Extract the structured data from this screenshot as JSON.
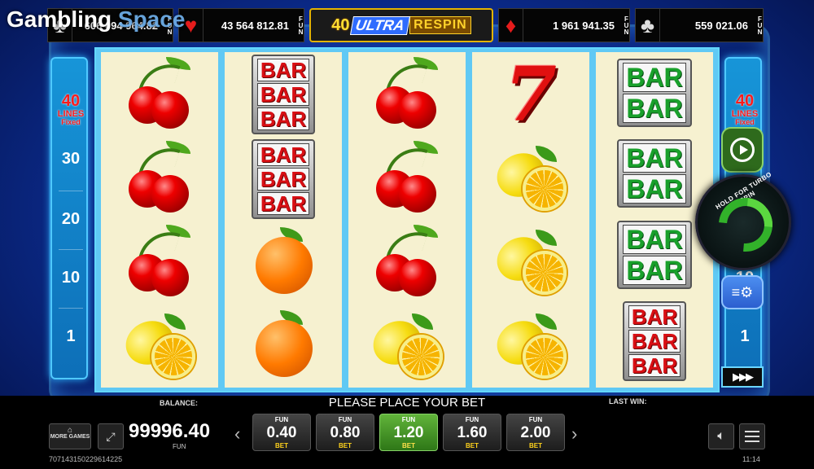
{
  "watermark": {
    "part1": "Gambling",
    "part2": "Space"
  },
  "jackpots": [
    {
      "suit": "club-icon",
      "glyph": "♣",
      "value": "606 094 964.82",
      "currency": "FUN"
    },
    {
      "suit": "heart-icon",
      "glyph": "♥",
      "value": "43 564 812.81",
      "currency": "FUN"
    },
    {
      "suit": "diamond-icon",
      "glyph": "♦",
      "value": "1 961 941.35",
      "currency": "FUN"
    },
    {
      "suit": "club-icon",
      "glyph": "♣",
      "value": "559 021.06",
      "currency": "FUN"
    }
  ],
  "logo": {
    "number": "40",
    "ultra": "ULTRA",
    "respin": "RESPIN"
  },
  "lines_panel": {
    "count": "40",
    "label": "LINES",
    "fixed": "Fixed",
    "numbers": [
      "30",
      "20",
      "10",
      "1"
    ]
  },
  "reels": [
    [
      "cherry",
      "cherry",
      "cherry",
      "lemon"
    ],
    [
      "bar3-red",
      "bar3-red",
      "orange",
      "orange"
    ],
    [
      "cherry",
      "cherry",
      "cherry",
      "lemon"
    ],
    [
      "seven",
      "lemon",
      "lemon",
      "lemon"
    ],
    [
      "bar2-green",
      "bar2-green",
      "bar2-green",
      "bar3-red"
    ]
  ],
  "spin_button": {
    "caption": "HOLD FOR TURBO SPIN"
  },
  "bottom": {
    "balance_label": "BALANCE:",
    "balance_value": "99996.40",
    "balance_unit": "FUN",
    "message": "PLEASE PLACE YOUR BET",
    "last_win_label": "LAST WIN:",
    "more_games": "MORE GAMES",
    "bets": [
      {
        "top": "FUN",
        "value": "0.40",
        "label": "BET",
        "active": false
      },
      {
        "top": "FUN",
        "value": "0.80",
        "label": "BET",
        "active": false
      },
      {
        "top": "FUN",
        "value": "1.20",
        "label": "BET",
        "active": true
      },
      {
        "top": "FUN",
        "value": "1.60",
        "label": "BET",
        "active": false
      },
      {
        "top": "FUN",
        "value": "2.00",
        "label": "BET",
        "active": false
      }
    ],
    "ticket_id": "707143150229614225",
    "clock": "11:14"
  }
}
